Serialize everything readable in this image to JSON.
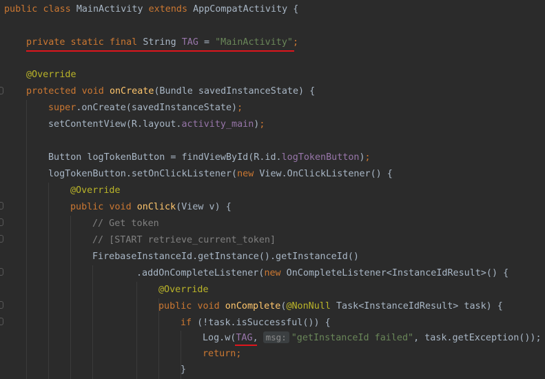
{
  "code": {
    "l1": {
      "kw1": "public",
      "kw2": "class",
      "name": "MainActivity",
      "kw3": "extends",
      "parent": "AppCompatActivity {"
    },
    "l2": {
      "kw1": "private",
      "kw2": "static",
      "kw3": "final",
      "type": "String",
      "field": "TAG",
      "eq": " = ",
      "str": "\"MainActivity\"",
      "semi": ";"
    },
    "l3": {
      "anno": "@Override"
    },
    "l4": {
      "kw1": "protected",
      "kw2": "void",
      "fn": "onCreate",
      "rest": "(Bundle savedInstanceState) {"
    },
    "l5": {
      "kw": "super",
      "rest": ".onCreate(savedInstanceState)",
      "semi": ";"
    },
    "l6": {
      "pre": "setContentView(R.layout.",
      "field": "activity_main",
      "post": ")",
      "semi": ";"
    },
    "l7": {
      "pre": "Button logTokenButton = findViewById(R.id.",
      "field": "logTokenButton",
      "post": ")",
      "semi": ";"
    },
    "l8": {
      "pre": "logTokenButton.setOnClickListener(",
      "kw": "new",
      "post": " View.OnClickListener() {"
    },
    "l9": {
      "anno": "@Override"
    },
    "l10": {
      "kw1": "public",
      "kw2": "void",
      "fn": "onClick",
      "rest": "(View v) {"
    },
    "l11": {
      "cmt": "// Get token"
    },
    "l12": {
      "cmt": "// [START retrieve_current_token]"
    },
    "l13": {
      "text": "FirebaseInstanceId.getInstance().getInstanceId()"
    },
    "l14": {
      "pre": ".addOnCompleteListener(",
      "kw": "new",
      "post": " OnCompleteListener<InstanceIdResult>() {"
    },
    "l15": {
      "anno": "@Override"
    },
    "l16": {
      "kw1": "public",
      "kw2": "void",
      "fn": "onComplete",
      "pre": "(",
      "anno": "@NonNull",
      "post": " Task<InstanceIdResult> task) {"
    },
    "l17": {
      "kw": "if",
      "rest": " (!task.isSuccessful()) {"
    },
    "l18": {
      "pre": "Log.w(",
      "field": "TAG",
      "comma": ",",
      "hint": "msg:",
      "str": "\"getInstanceId failed\"",
      "post": ", task.getException());"
    },
    "l19": {
      "kw": "return",
      "semi": ";"
    },
    "l20": {
      "text": "}"
    }
  },
  "colors": {
    "background": "#2b2b2b",
    "default_text": "#a9b7c6",
    "keyword": "#cc7832",
    "method": "#ffc66d",
    "string": "#6a8759",
    "annotation": "#bbb529",
    "comment": "#808080",
    "field": "#9876aa",
    "highlight_underline": "#e0151c"
  }
}
